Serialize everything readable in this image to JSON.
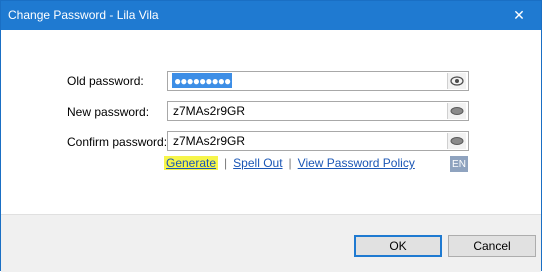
{
  "window": {
    "title": "Change Password - Lila Vila",
    "close_glyph": "✕"
  },
  "form": {
    "old_password": {
      "label": "Old password:",
      "value": "●●●●●●●●●",
      "toggle_icon": "eye-icon"
    },
    "new_password": {
      "label": "New password:",
      "value": "z7MAs2r9GR",
      "toggle_icon": "eye-closed-icon"
    },
    "confirm_password": {
      "label": "Confirm password:",
      "value": "z7MAs2r9GR",
      "toggle_icon": "eye-closed-icon"
    }
  },
  "links": {
    "generate": "Generate",
    "spell_out": "Spell Out",
    "view_policy": "View Password Policy",
    "separator": "|"
  },
  "language_indicator": "EN",
  "buttons": {
    "ok": "OK",
    "cancel": "Cancel"
  },
  "colors": {
    "titlebar": "#1f7ad1",
    "link": "#1a56b5",
    "highlight": "#f6f54a",
    "selection": "#3d8ee6"
  }
}
